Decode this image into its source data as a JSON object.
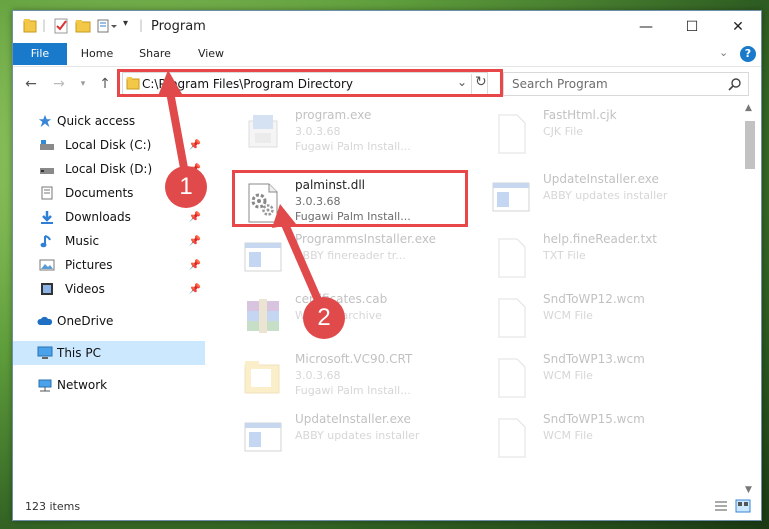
{
  "window": {
    "title": "Program",
    "controls": {
      "minimize": "—",
      "maximize": "☐",
      "close": "✕"
    }
  },
  "ribbon": {
    "tabs": [
      {
        "label": "File",
        "active": true
      },
      {
        "label": "Home"
      },
      {
        "label": "Share"
      },
      {
        "label": "View"
      }
    ],
    "help": "?"
  },
  "navigation": {
    "address": "C:\\Program Files\\Program Directory",
    "search_placeholder": "Search Program"
  },
  "sidebar": {
    "items": [
      {
        "label": "Quick access",
        "icon": "star-icon",
        "pinned": false
      },
      {
        "label": "Local Disk (C:)",
        "icon": "disk-icon",
        "pinned": true
      },
      {
        "label": "Local Disk (D:)",
        "icon": "disk-icon",
        "pinned": true
      },
      {
        "label": "Documents",
        "icon": "documents-icon",
        "pinned": true
      },
      {
        "label": "Downloads",
        "icon": "download-icon",
        "pinned": true
      },
      {
        "label": "Music",
        "icon": "music-icon",
        "pinned": true
      },
      {
        "label": "Pictures",
        "icon": "pictures-icon",
        "pinned": true
      },
      {
        "label": "Videos",
        "icon": "videos-icon",
        "pinned": true
      },
      {
        "label": "OneDrive",
        "icon": "cloud-icon"
      },
      {
        "label": "This PC",
        "icon": "computer-icon",
        "selected": true
      },
      {
        "label": "Network",
        "icon": "network-icon"
      }
    ]
  },
  "files": [
    {
      "name": "program.exe",
      "line2": "3.0.3.68",
      "line3": "Fugawi Palm Install...",
      "icon": "installer-icon"
    },
    {
      "name": "FastHtml.cjk",
      "line2": "CJK File",
      "line3": "",
      "icon": "file-icon"
    },
    {
      "name": "palminst.dll",
      "line2": "3.0.3.68",
      "line3": "Fugawi Palm Install...",
      "icon": "dll-gear-icon",
      "highlighted": true
    },
    {
      "name": "UpdateInstaller.exe",
      "line2": "ABBY updates installer",
      "line3": "",
      "icon": "window-app-icon"
    },
    {
      "name": "ProgrammsInstaller.exe",
      "line2": "ABBY finereader tr...",
      "line3": "",
      "icon": "window-app-icon"
    },
    {
      "name": "help.fineReader.txt",
      "line2": "TXT File",
      "line3": "",
      "icon": "file-icon"
    },
    {
      "name": "certificates.cab",
      "line2": "WinRAR archive",
      "line3": "",
      "icon": "archive-icon"
    },
    {
      "name": "SndToWP12.wcm",
      "line2": "WCM File",
      "line3": "",
      "icon": "file-icon"
    },
    {
      "name": "Microsoft.VC90.CRT",
      "line2": "3.0.3.68",
      "line3": "Fugawi Palm Install...",
      "icon": "folder-icon"
    },
    {
      "name": "SndToWP13.wcm",
      "line2": "WCM File",
      "line3": "",
      "icon": "file-icon"
    },
    {
      "name": "UpdateInstaller.exe",
      "line2": "ABBY updates installer",
      "line3": "",
      "icon": "window-app-icon"
    },
    {
      "name": "SndToWP15.wcm",
      "line2": "WCM File",
      "line3": "",
      "icon": "file-icon"
    }
  ],
  "status": {
    "count": "123 items"
  },
  "annotations": {
    "step1": "1",
    "step2": "2"
  },
  "colors": {
    "accent": "#1979ca",
    "highlight": "#e8474a",
    "selected": "#cce8ff"
  }
}
